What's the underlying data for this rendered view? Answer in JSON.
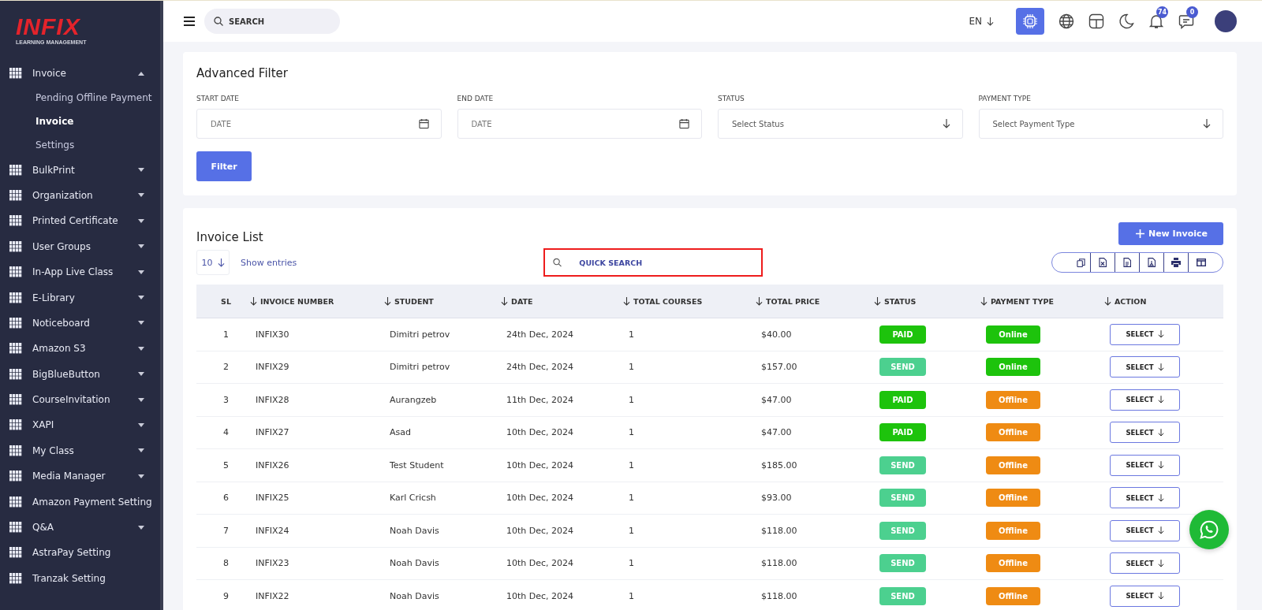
{
  "brand": {
    "logo": "INFIX",
    "tagline": "LEARNING MANAGEMENT"
  },
  "sidebar": {
    "items": [
      {
        "label": "Invoice",
        "expandable": true,
        "expanded": true,
        "children": [
          {
            "label": "Pending Offline Payment",
            "selected": false
          },
          {
            "label": "Invoice",
            "selected": true
          },
          {
            "label": "Settings",
            "selected": false
          }
        ]
      },
      {
        "label": "BulkPrint",
        "expandable": true,
        "expanded": false
      },
      {
        "label": "Organization",
        "expandable": true,
        "expanded": false
      },
      {
        "label": "Printed Certificate",
        "expandable": true,
        "expanded": false
      },
      {
        "label": "User Groups",
        "expandable": true,
        "expanded": false
      },
      {
        "label": "In-App Live Class",
        "expandable": true,
        "expanded": false
      },
      {
        "label": "E-Library",
        "expandable": true,
        "expanded": false
      },
      {
        "label": "Noticeboard",
        "expandable": true,
        "expanded": false
      },
      {
        "label": "Amazon S3",
        "expandable": true,
        "expanded": false
      },
      {
        "label": "BigBlueButton",
        "expandable": true,
        "expanded": false
      },
      {
        "label": "CourseInvitation",
        "expandable": true,
        "expanded": false
      },
      {
        "label": "XAPI",
        "expandable": true,
        "expanded": false
      },
      {
        "label": "My Class",
        "expandable": true,
        "expanded": false
      },
      {
        "label": "Media Manager",
        "expandable": true,
        "expanded": false
      },
      {
        "label": "Amazon Payment Setting",
        "expandable": false
      },
      {
        "label": "Q&A",
        "expandable": true,
        "expanded": false
      },
      {
        "label": "AstraPay Setting",
        "expandable": false
      },
      {
        "label": "Tranzak Setting",
        "expandable": false
      }
    ]
  },
  "topbar": {
    "search": {
      "placeholder": "SEARCH"
    },
    "language": "EN",
    "notifications": "74",
    "messages": "0"
  },
  "filter": {
    "title": "Advanced Filter",
    "fields": [
      {
        "label": "START DATE",
        "kind": "date",
        "placeholder": "DATE"
      },
      {
        "label": "END DATE",
        "kind": "date",
        "placeholder": "DATE"
      },
      {
        "label": "STATUS",
        "kind": "select",
        "placeholder": "Select Status"
      },
      {
        "label": "PAYMENT TYPE",
        "kind": "select",
        "placeholder": "Select Payment Type"
      }
    ],
    "button": "Filter"
  },
  "list": {
    "title": "Invoice List",
    "new_button": "New Invoice",
    "page_size": "10",
    "show_entries": "Show entries",
    "quick_search": {
      "placeholder": "QUICK SEARCH"
    },
    "columns": [
      {
        "label": "SL",
        "sortable": false
      },
      {
        "label": "INVOICE NUMBER",
        "sortable": true
      },
      {
        "label": "STUDENT",
        "sortable": true
      },
      {
        "label": "DATE",
        "sortable": true
      },
      {
        "label": "TOTAL COURSES",
        "sortable": true
      },
      {
        "label": "TOTAL PRICE",
        "sortable": true
      },
      {
        "label": "STATUS",
        "sortable": true
      },
      {
        "label": "PAYMENT TYPE",
        "sortable": true
      },
      {
        "label": "ACTION",
        "sortable": true
      }
    ],
    "rows": [
      {
        "sl": "1",
        "number": "INFIX30",
        "student": "Dimitri petrov",
        "date": "24th Dec, 2024",
        "courses": "1",
        "price": "$40.00",
        "status": {
          "label": "PAID",
          "kind": "paid"
        },
        "payment": {
          "label": "Online",
          "kind": "online"
        },
        "action": "SELECT"
      },
      {
        "sl": "2",
        "number": "INFIX29",
        "student": "Dimitri petrov",
        "date": "24th Dec, 2024",
        "courses": "1",
        "price": "$157.00",
        "status": {
          "label": "SEND",
          "kind": "send"
        },
        "payment": {
          "label": "Online",
          "kind": "online"
        },
        "action": "SELECT"
      },
      {
        "sl": "3",
        "number": "INFIX28",
        "student": "Aurangzeb",
        "date": "11th Dec, 2024",
        "courses": "1",
        "price": "$47.00",
        "status": {
          "label": "PAID",
          "kind": "paid"
        },
        "payment": {
          "label": "Offline",
          "kind": "offline"
        },
        "action": "SELECT"
      },
      {
        "sl": "4",
        "number": "INFIX27",
        "student": "Asad",
        "date": "10th Dec, 2024",
        "courses": "1",
        "price": "$47.00",
        "status": {
          "label": "PAID",
          "kind": "paid"
        },
        "payment": {
          "label": "Offline",
          "kind": "offline"
        },
        "action": "SELECT"
      },
      {
        "sl": "5",
        "number": "INFIX26",
        "student": "Test Student",
        "date": "10th Dec, 2024",
        "courses": "1",
        "price": "$185.00",
        "status": {
          "label": "SEND",
          "kind": "send"
        },
        "payment": {
          "label": "Offline",
          "kind": "offline"
        },
        "action": "SELECT"
      },
      {
        "sl": "6",
        "number": "INFIX25",
        "student": "Karl Cricsh",
        "date": "10th Dec, 2024",
        "courses": "1",
        "price": "$93.00",
        "status": {
          "label": "SEND",
          "kind": "send"
        },
        "payment": {
          "label": "Offline",
          "kind": "offline"
        },
        "action": "SELECT"
      },
      {
        "sl": "7",
        "number": "INFIX24",
        "student": "Noah Davis",
        "date": "10th Dec, 2024",
        "courses": "1",
        "price": "$118.00",
        "status": {
          "label": "SEND",
          "kind": "send"
        },
        "payment": {
          "label": "Offline",
          "kind": "offline"
        },
        "action": "SELECT"
      },
      {
        "sl": "8",
        "number": "INFIX23",
        "student": "Noah Davis",
        "date": "10th Dec, 2024",
        "courses": "1",
        "price": "$118.00",
        "status": {
          "label": "SEND",
          "kind": "send"
        },
        "payment": {
          "label": "Offline",
          "kind": "offline"
        },
        "action": "SELECT"
      },
      {
        "sl": "9",
        "number": "INFIX22",
        "student": "Noah Davis",
        "date": "10th Dec, 2024",
        "courses": "1",
        "price": "$118.00",
        "status": {
          "label": "SEND",
          "kind": "send"
        },
        "payment": {
          "label": "Offline",
          "kind": "offline"
        },
        "action": "SELECT"
      }
    ]
  }
}
